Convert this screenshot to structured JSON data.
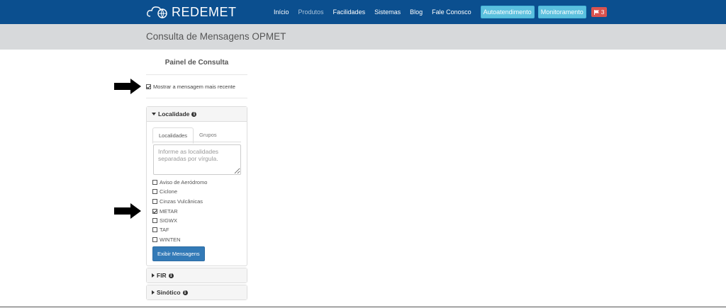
{
  "brand": {
    "name": "REDEMET",
    "logo_icon": "cloud-globe-icon"
  },
  "nav": {
    "links": [
      "Início",
      "Produtos",
      "Facilidades",
      "Sistemas",
      "Blog",
      "Fale Conosco"
    ],
    "active": "Produtos",
    "buttons": [
      "Autoatendimento",
      "Monitoramento"
    ],
    "badge": {
      "icon": "flag-icon",
      "count": "3"
    }
  },
  "page": {
    "title": "Consulta de Mensagens OPMET"
  },
  "panel": {
    "title": "Painel de Consulta",
    "recent_label": "Mostrar a mensagem mais recente",
    "recent_checked": true
  },
  "localidade": {
    "title": "Localidade",
    "tabs": [
      "Localidades",
      "Grupos"
    ],
    "placeholder": "Informe as localidades separadas por vírgula.",
    "options": [
      {
        "label": "Aviso de Aeródromo",
        "checked": false
      },
      {
        "label": "Ciclone",
        "checked": false
      },
      {
        "label": "Cinzas Vulcânicas",
        "checked": false
      },
      {
        "label": "METAR",
        "checked": true
      },
      {
        "label": "SIGWX",
        "checked": false
      },
      {
        "label": "TAF",
        "checked": false
      },
      {
        "label": "WINTEN",
        "checked": false
      }
    ],
    "submit": "Exibir Mensagens"
  },
  "fir": {
    "title": "FIR"
  },
  "sinotico": {
    "title": "Sinótico"
  },
  "colors": {
    "navbar": "#0b4f8f",
    "accent_info": "#5bc0de",
    "danger": "#d9534f",
    "primary": "#337ab7"
  }
}
